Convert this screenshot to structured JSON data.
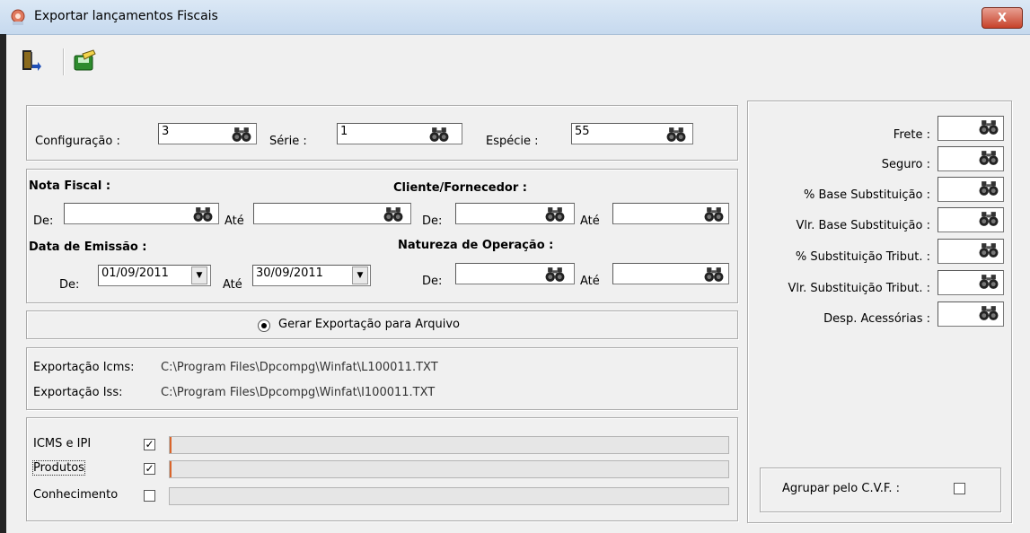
{
  "window": {
    "title": "Exportar lançamentos Fiscais",
    "close_label": "X"
  },
  "toolbar": {
    "exit_icon": "exit-door-icon",
    "export_icon": "export-disk-icon"
  },
  "config": {
    "configuracao_label": "Configuração :",
    "configuracao_value": "3",
    "serie_label": "Série :",
    "serie_value": "1",
    "especie_label": "Espécie :",
    "especie_value": "55"
  },
  "filters": {
    "nota_fiscal_label": "Nota Fiscal :",
    "cliente_label": "Cliente/Fornecedor :",
    "de_label": "De:",
    "ate_label": "Até",
    "nf_de_value": "",
    "nf_ate_value": "",
    "cli_de_value": "",
    "cli_ate_value": "",
    "data_emissao_label": "Data de Emissão :",
    "natureza_label": "Natureza de Operação :",
    "data_de_value": "01/09/2011",
    "data_ate_value": "30/09/2011",
    "nat_de_value": "",
    "nat_ate_value": ""
  },
  "radio": {
    "label": "Gerar Exportação para Arquivo",
    "selected": true
  },
  "paths": {
    "icms_label": "Exportação Icms:",
    "icms_value": "C:\\Program Files\\Dpcompg\\Winfat\\L100011.TXT",
    "iss_label": "Exportação Iss:",
    "iss_value": "C:\\Program Files\\Dpcompg\\Winfat\\I100011.TXT"
  },
  "options": [
    {
      "label": "ICMS e IPI",
      "checked": true,
      "progress": 0
    },
    {
      "label": "Produtos",
      "checked": true,
      "progress": 0
    },
    {
      "label": "Conhecimento",
      "checked": false,
      "progress": 0
    }
  ],
  "right_panel": {
    "fields": [
      {
        "label": "Frete :",
        "value": ""
      },
      {
        "label": "Seguro :",
        "value": ""
      },
      {
        "label": "% Base Substituição :",
        "value": ""
      },
      {
        "label": "Vlr. Base Substituição :",
        "value": ""
      },
      {
        "label": "% Substituição Tribut. :",
        "value": ""
      },
      {
        "label": "Vlr. Substituição Tribut. :",
        "value": ""
      },
      {
        "label": "Desp. Acessórias :",
        "value": ""
      }
    ],
    "agrupar_label": "Agrupar pelo C.V.F. :",
    "agrupar_checked": false
  }
}
